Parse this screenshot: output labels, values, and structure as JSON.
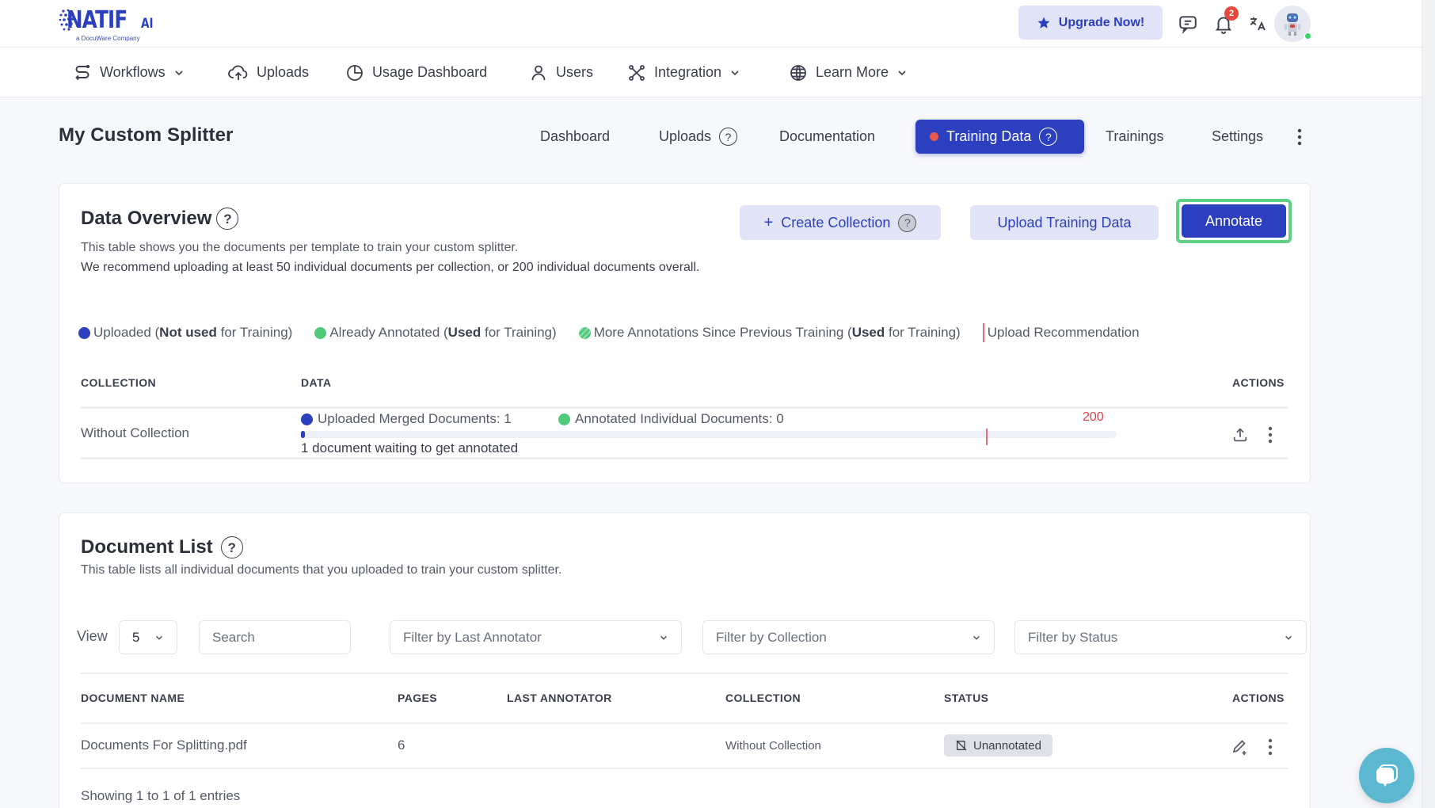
{
  "app": {
    "logo_text": "NATIF",
    "logo_suffix": "AI",
    "logo_tagline": "a DocuWare Company",
    "upgrade_label": "Upgrade Now!",
    "notification_count": "2"
  },
  "nav": {
    "items": [
      {
        "label": "Workflows",
        "icon": "workflow-icon",
        "dropdown": true
      },
      {
        "label": "Uploads",
        "icon": "cloud-upload-icon",
        "dropdown": false
      },
      {
        "label": "Usage Dashboard",
        "icon": "pie-chart-icon",
        "dropdown": false
      },
      {
        "label": "Users",
        "icon": "user-icon",
        "dropdown": false
      },
      {
        "label": "Integration",
        "icon": "integration-icon",
        "dropdown": true
      },
      {
        "label": "Learn More",
        "icon": "globe-icon",
        "dropdown": true
      }
    ]
  },
  "page": {
    "title": "My Custom Splitter",
    "tabs": [
      {
        "label": "Dashboard",
        "active": false
      },
      {
        "label": "Uploads",
        "active": false,
        "help": true
      },
      {
        "label": "Documentation",
        "active": false
      },
      {
        "label": "Training Data",
        "active": true,
        "help": true,
        "indicator": true
      },
      {
        "label": "Trainings",
        "active": false
      },
      {
        "label": "Settings",
        "active": false
      }
    ]
  },
  "overview": {
    "title": "Data Overview",
    "desc1": "This table shows you the documents per template to train your custom splitter.",
    "desc2": "We recommend uploading at least 50 individual documents per collection, or 200 individual documents overall.",
    "create_collection_label": "Create Collection",
    "upload_training_label": "Upload Training Data",
    "annotate_label": "Annotate",
    "legend": {
      "uploaded_a": "Uploaded (",
      "uploaded_b": "Not used",
      "uploaded_c": " for Training)",
      "annotated_a": "Already Annotated (",
      "annotated_b": "Used",
      "annotated_c": " for Training)",
      "more_a": "More Annotations Since Previous Training (",
      "more_b": "Used",
      "more_c": " for Training)",
      "recommendation": "Upload Recommendation"
    },
    "columns": {
      "collection": "COLLECTION",
      "data": "DATA",
      "actions": "ACTIONS"
    },
    "rows": [
      {
        "collection": "Without Collection",
        "uploaded_label": "Uploaded Merged Documents: 1",
        "annotated_label": "Annotated Individual Documents: 0",
        "uploaded_count": 1,
        "annotated_count": 0,
        "recommendation": "200",
        "waiting_text": "1 document waiting to get annotated"
      }
    ]
  },
  "doclist": {
    "title": "Document List",
    "desc": "This table lists all individual documents that you uploaded to train your custom splitter.",
    "view_label": "View",
    "view_value": "5",
    "search_placeholder": "Search",
    "filter_annotator": "Filter by Last Annotator",
    "filter_collection": "Filter by Collection",
    "filter_status": "Filter by Status",
    "columns": {
      "name": "DOCUMENT NAME",
      "pages": "PAGES",
      "annotator": "LAST ANNOTATOR",
      "collection": "COLLECTION",
      "status": "STATUS",
      "actions": "ACTIONS"
    },
    "rows": [
      {
        "name": "Documents For Splitting.pdf",
        "pages": "6",
        "annotator": "",
        "collection": "Without Collection",
        "status": "Unannotated"
      }
    ],
    "footer": "Showing 1 to 1 of 1 entries"
  },
  "colors": {
    "primary": "#2b3fbf",
    "uploaded": "#2b3fbf",
    "annotated": "#4fc97a",
    "recommendation": "#e0404b",
    "highlight": "#5fd184",
    "chat": "#5bb8d0"
  }
}
